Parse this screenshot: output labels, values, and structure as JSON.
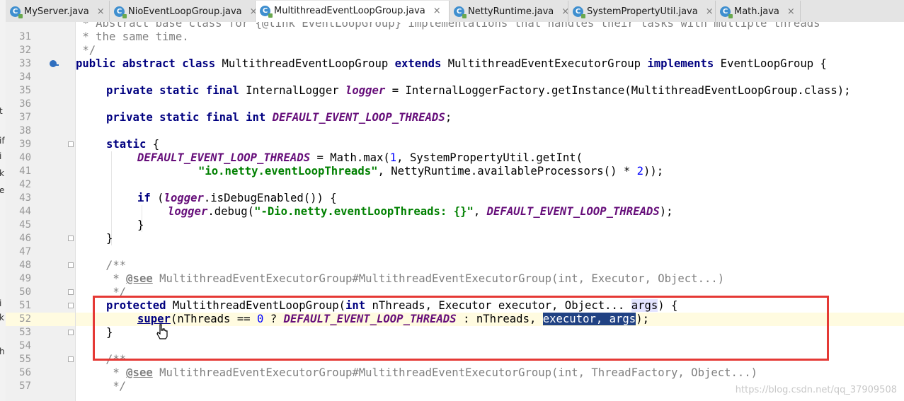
{
  "tabs": [
    {
      "label": "MyServer.java",
      "icon": "class-icon",
      "active": false
    },
    {
      "label": "NioEventLoopGroup.java",
      "icon": "class-icon",
      "active": false
    },
    {
      "label": "MultithreadEventLoopGroup.java",
      "icon": "class-icon",
      "active": true
    },
    {
      "label": "NettyRuntime.java",
      "icon": "class-icon",
      "active": false
    },
    {
      "label": "SystemPropertyUtil.java",
      "icon": "class-icon",
      "active": false
    },
    {
      "label": "Math.java",
      "icon": "class-icon",
      "active": false
    }
  ],
  "tab_close_glyph": "×",
  "left_panel_letters": [
    "t",
    "if",
    "i",
    "k",
    "e",
    "i",
    "k",
    "h"
  ],
  "line_numbers": [
    "31",
    "32",
    "33",
    "34",
    "35",
    "36",
    "37",
    "38",
    "39",
    "40",
    "41",
    "42",
    "43",
    "44",
    "45",
    "46",
    "47",
    "48",
    "49",
    "50",
    "51",
    "52",
    "53",
    "54",
    "55",
    "56",
    "57"
  ],
  "code_top_fragment": " * Abstract base class for {@link EventLoopGroup} implementations that handles their tasks with multiple threads",
  "code": {
    "l31": [
      " * the same time."
    ],
    "l32": [
      " */"
    ],
    "l33": [
      "public abstract class",
      " MultithreadEventLoopGroup ",
      "extends",
      " MultithreadEventExecutorGroup ",
      "implements",
      " EventLoopGroup {"
    ],
    "l35": [
      "private static final",
      " InternalLogger ",
      "logger",
      " = InternalLoggerFactory.getInstance(MultithreadEventLoopGroup.class);"
    ],
    "l37": [
      "private static final int",
      " ",
      "DEFAULT_EVENT_LOOP_THREADS",
      ";"
    ],
    "l39": [
      "static",
      " {"
    ],
    "l40": [
      "DEFAULT_EVENT_LOOP_THREADS",
      " = Math.max(",
      "1",
      ", SystemPropertyUtil.getInt("
    ],
    "l41": [
      "\"io.netty.eventLoopThreads\"",
      ", NettyRuntime.availableProcessors() * ",
      "2",
      "));"
    ],
    "l43": [
      "if",
      " (",
      "logger",
      ".isDebugEnabled()) {"
    ],
    "l44": [
      "logger",
      ".debug(",
      "\"-Dio.netty.eventLoopThreads: {}\"",
      ", ",
      "DEFAULT_EVENT_LOOP_THREADS",
      ");"
    ],
    "l45": [
      "}"
    ],
    "l46": [
      "}"
    ],
    "l48": [
      "/**"
    ],
    "l49": [
      " * ",
      "@see",
      " MultithreadEventExecutorGroup#MultithreadEventExecutorGroup(int, Executor, Object...)"
    ],
    "l50": [
      " */"
    ],
    "l51": [
      "protected",
      " MultithreadEventLoopGroup(",
      "int",
      " nThreads, Executor executor, Object... ",
      "args",
      ") {"
    ],
    "l52": [
      "super",
      "(nThreads == ",
      "0",
      " ? ",
      "DEFAULT_EVENT_LOOP_THREADS",
      " : nThreads, ",
      "executor, args",
      ");"
    ],
    "l53": [
      "}"
    ],
    "l55": [
      "/**"
    ],
    "l56": [
      " * ",
      "@see",
      " MultithreadEventExecutorGroup#MultithreadEventExecutorGroup(int, ThreadFactory, Object...)"
    ],
    "l57": [
      " */"
    ]
  },
  "watermark": "https://blog.csdn.net/qq_37909508",
  "colors": {
    "keyword": "#000080",
    "string": "#008000",
    "number": "#0000ff",
    "static_field": "#660e7a",
    "comment": "#808080",
    "selection": "#214283",
    "annotation_box": "#e53935",
    "current_line": "#fffbe0"
  }
}
